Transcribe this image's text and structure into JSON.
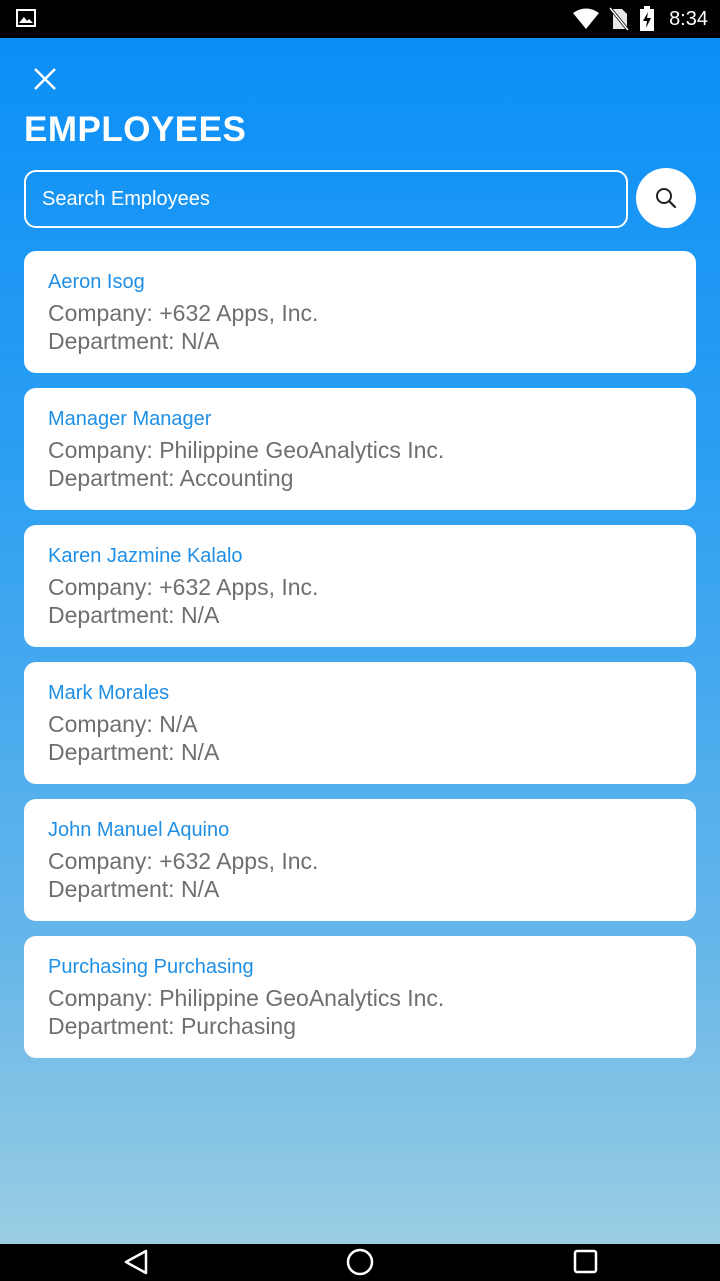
{
  "status_bar": {
    "time": "8:34"
  },
  "header": {
    "title": "EMPLOYEES",
    "search_placeholder": "Search Employees"
  },
  "employees": [
    {
      "name": "Aeron Isog",
      "company": "Company: +632 Apps, Inc.",
      "department": "Department: N/A"
    },
    {
      "name": "Manager Manager",
      "company": "Company: Philippine GeoAnalytics Inc.",
      "department": "Department: Accounting"
    },
    {
      "name": "Karen Jazmine Kalalo",
      "company": "Company: +632 Apps, Inc.",
      "department": "Department: N/A"
    },
    {
      "name": "Mark Morales",
      "company": "Company: N/A",
      "department": "Department: N/A"
    },
    {
      "name": "John Manuel Aquino",
      "company": "Company: +632 Apps, Inc.",
      "department": "Department: N/A"
    },
    {
      "name": "Purchasing Purchasing",
      "company": "Company: Philippine GeoAnalytics Inc.",
      "department": "Department: Purchasing"
    }
  ],
  "colors": {
    "accent": "#1f8fe6",
    "gradient_top": "#0b8ff7",
    "gradient_bottom": "#9acde2"
  }
}
